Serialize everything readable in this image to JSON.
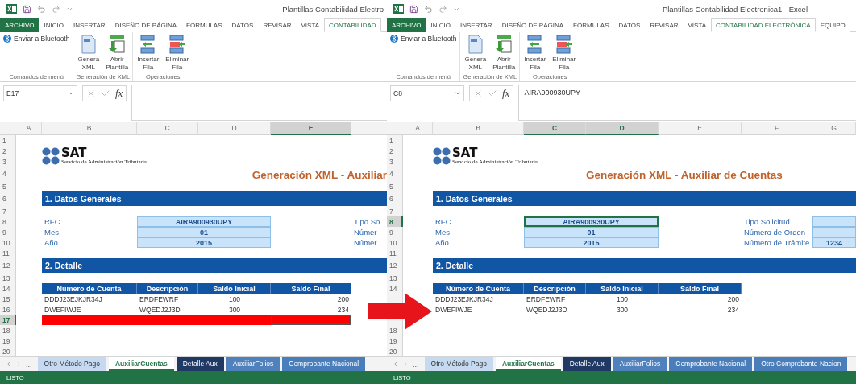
{
  "windows": [
    {
      "title": "Plantillas Contabilidad Electro",
      "menu_tabs": [
        {
          "label": "ARCHIVO",
          "kind": "file",
          "selected": false
        },
        {
          "label": "INICIO",
          "kind": "tab",
          "selected": false
        },
        {
          "label": "INSERTAR",
          "kind": "tab",
          "selected": false
        },
        {
          "label": "DISEÑO DE PÁGINA",
          "kind": "tab",
          "selected": false
        },
        {
          "label": "FÓRMULAS",
          "kind": "tab",
          "selected": false
        },
        {
          "label": "DATOS",
          "kind": "tab",
          "selected": false
        },
        {
          "label": "REVISAR",
          "kind": "tab",
          "selected": false
        },
        {
          "label": "VISTA",
          "kind": "tab",
          "selected": false
        },
        {
          "label": "CONTABILIDAD",
          "kind": "tab",
          "selected": true
        }
      ],
      "ribbon_groups": [
        {
          "label": "Comandos de menú",
          "commands": [
            {
              "label": "Enviar a Bluetooth",
              "kind": "small"
            }
          ]
        },
        {
          "label": "Generación de XML",
          "commands": [
            {
              "label": "Genera XML",
              "kind": "large"
            },
            {
              "label": "Abrir Plantilla",
              "kind": "large"
            }
          ]
        },
        {
          "label": "Operaciones",
          "commands": [
            {
              "label": "Insertar Fila",
              "kind": "large"
            },
            {
              "label": "Eliminar Fila",
              "kind": "large"
            }
          ]
        }
      ],
      "name_box": "E17",
      "formula_label": "fx",
      "columns": [
        {
          "label": "A",
          "selected": false
        },
        {
          "label": "B",
          "selected": false
        },
        {
          "label": "C",
          "selected": false
        },
        {
          "label": "D",
          "selected": false
        },
        {
          "label": "E",
          "selected": true
        }
      ],
      "rows": [
        {
          "label": "1",
          "selected": false
        },
        {
          "label": "2",
          "selected": false
        },
        {
          "label": "3",
          "selected": false
        },
        {
          "label": "4",
          "selected": false
        },
        {
          "label": "5",
          "selected": false
        },
        {
          "label": "6",
          "selected": false
        },
        {
          "label": "7",
          "selected": false
        },
        {
          "label": "8",
          "selected": false
        },
        {
          "label": "9",
          "selected": false
        },
        {
          "label": "10",
          "selected": false
        },
        {
          "label": "11",
          "selected": false
        },
        {
          "label": "12",
          "selected": false
        },
        {
          "label": "13",
          "selected": false
        },
        {
          "label": "14",
          "selected": false
        },
        {
          "label": "15",
          "selected": false
        },
        {
          "label": "16",
          "selected": false
        },
        {
          "label": "17",
          "selected": true
        },
        {
          "label": "18",
          "selected": false
        },
        {
          "label": "19",
          "selected": false
        },
        {
          "label": "20",
          "selected": false
        }
      ],
      "logo": {
        "text": "SAT",
        "subtitle": "Servicio de Administración Tributaria"
      },
      "heading": "Generación XML - Auxiliar",
      "sections": [
        "1. Datos Generales",
        "2. Detalle"
      ],
      "general_fields": [
        {
          "label": "RFC",
          "value": "AIRA900930UPY",
          "selected": false
        },
        {
          "label": "Mes",
          "value": "01",
          "selected": false
        },
        {
          "label": "Año",
          "value": "2015",
          "selected": false
        }
      ],
      "request_fields": [
        {
          "label": "Tipo So",
          "kind": "label"
        },
        {
          "label": "Númer",
          "kind": "label"
        },
        {
          "label": "Númer",
          "kind": "label"
        }
      ],
      "detail_table": {
        "columns": [
          "Número de Cuenta",
          "Descripción",
          "Saldo Inicial",
          "Saldo Final"
        ],
        "rows": [
          {
            "kind": "data",
            "cells": [
              "DDDJ23EJKJR34J",
              "ERDFEWRF",
              "100",
              "200"
            ]
          },
          {
            "kind": "data",
            "cells": [
              "DWEFIWJE",
              "WQEDJ2J3D",
              "300",
              "234"
            ]
          },
          {
            "kind": "inserted",
            "selected": true
          }
        ]
      },
      "sheet_more": "...",
      "sheet_tabs": [
        {
          "label": "Otro Método Pago",
          "color": "#c5d9f1",
          "selected": false
        },
        {
          "label": "AuxiliarCuentas",
          "color": "#ffffff",
          "selected": true
        },
        {
          "label": "Detalle Aux",
          "color": "#1f3864",
          "selected": false
        },
        {
          "label": "AuxiliarFolios",
          "color": "#4f81bd",
          "selected": false
        },
        {
          "label": "Comprobante Nacional",
          "color": "#4a7ebb",
          "selected": false
        }
      ],
      "status": "LISTO"
    },
    {
      "title": "Plantillas Contabilidad Electronica1 - Excel",
      "menu_tabs": [
        {
          "label": "ARCHIVO",
          "kind": "file",
          "selected": false
        },
        {
          "label": "INICIO",
          "kind": "tab",
          "selected": false
        },
        {
          "label": "INSERTAR",
          "kind": "tab",
          "selected": false
        },
        {
          "label": "DISEÑO DE PÁGINA",
          "kind": "tab",
          "selected": false
        },
        {
          "label": "FÓRMULAS",
          "kind": "tab",
          "selected": false
        },
        {
          "label": "DATOS",
          "kind": "tab",
          "selected": false
        },
        {
          "label": "REVISAR",
          "kind": "tab",
          "selected": false
        },
        {
          "label": "VISTA",
          "kind": "tab",
          "selected": false
        },
        {
          "label": "CONTABILIDAD ELECTRÓNICA",
          "kind": "tab",
          "selected": true
        },
        {
          "label": "EQUIPO",
          "kind": "tab",
          "selected": false
        }
      ],
      "ribbon_groups": [
        {
          "label": "Comandos de menú",
          "commands": [
            {
              "label": "Enviar a Bluetooth",
              "kind": "small"
            }
          ]
        },
        {
          "label": "Generación de XML",
          "commands": [
            {
              "label": "Genera XML",
              "kind": "large"
            },
            {
              "label": "Abrir Plantilla",
              "kind": "large"
            }
          ]
        },
        {
          "label": "Operaciones",
          "commands": [
            {
              "label": "Insertar Fila",
              "kind": "large"
            },
            {
              "label": "Eliminar Fila",
              "kind": "large"
            }
          ]
        }
      ],
      "name_box": "C8",
      "formula_label": "fx",
      "formula": "AIRA900930UPY",
      "columns": [
        {
          "label": "A",
          "selected": false
        },
        {
          "label": "B",
          "selected": false
        },
        {
          "label": "C",
          "selected": true
        },
        {
          "label": "D",
          "selected": true
        },
        {
          "label": "E",
          "selected": false
        },
        {
          "label": "F",
          "selected": false
        },
        {
          "label": "G",
          "selected": false
        }
      ],
      "rows": [
        {
          "label": "1",
          "selected": false
        },
        {
          "label": "2",
          "selected": false
        },
        {
          "label": "3",
          "selected": false
        },
        {
          "label": "4",
          "selected": false
        },
        {
          "label": "5",
          "selected": false
        },
        {
          "label": "6",
          "selected": false
        },
        {
          "label": "7",
          "selected": false
        },
        {
          "label": "8",
          "selected": true
        },
        {
          "label": "9",
          "selected": false
        },
        {
          "label": "10",
          "selected": false
        },
        {
          "label": "11",
          "selected": false
        },
        {
          "label": "12",
          "selected": false
        },
        {
          "label": "13",
          "selected": false
        },
        {
          "label": "14",
          "selected": false
        },
        null,
        null,
        null,
        {
          "label": "18",
          "selected": false
        },
        {
          "label": "19",
          "selected": false
        },
        {
          "label": "20",
          "selected": false
        }
      ],
      "logo": {
        "text": "SAT",
        "subtitle": "Servicio de Administración Tributaria"
      },
      "heading": "Generación XML - Auxiliar de Cuentas",
      "sections": [
        "1. Datos Generales",
        "2. Detalle"
      ],
      "general_fields": [
        {
          "label": "RFC",
          "value": "AIRA900930UPY",
          "selected": true
        },
        {
          "label": "Mes",
          "value": "01",
          "selected": false
        },
        {
          "label": "Año",
          "value": "2015",
          "selected": false
        }
      ],
      "request_fields": [
        {
          "label": "Tipo Solicitud",
          "kind": "input"
        },
        {
          "label": "Número de Orden",
          "kind": "input"
        },
        {
          "label": "Número de Trámite",
          "kind": "input",
          "value": "1234"
        }
      ],
      "detail_table": {
        "columns": [
          "Número de Cuenta",
          "Descripción",
          "Saldo Inicial",
          "Saldo Final"
        ],
        "rows": [
          {
            "kind": "data",
            "cells": [
              "DDDJ23EJKJR34J",
              "ERDFEWRF",
              "100",
              "200"
            ]
          },
          {
            "kind": "data",
            "cells": [
              "DWEFIWJE",
              "WQEDJ2J3D",
              "300",
              "234"
            ]
          }
        ]
      },
      "sheet_more": "...",
      "sheet_tabs": [
        {
          "label": "Otro Método Pago",
          "color": "#c5d9f1",
          "selected": false
        },
        {
          "label": "AuxiliarCuentas",
          "color": "#ffffff",
          "selected": true
        },
        {
          "label": "Detalle Aux",
          "color": "#1f3864",
          "selected": false
        },
        {
          "label": "AuxiliarFolios",
          "color": "#4f81bd",
          "selected": false
        },
        {
          "label": "Comprobante Nacional",
          "color": "#4a7ebb",
          "selected": false
        },
        {
          "label": "Otro Comprobante Nacion",
          "color": "#4a7ebb",
          "selected": false
        }
      ],
      "status": "LISTO"
    }
  ]
}
